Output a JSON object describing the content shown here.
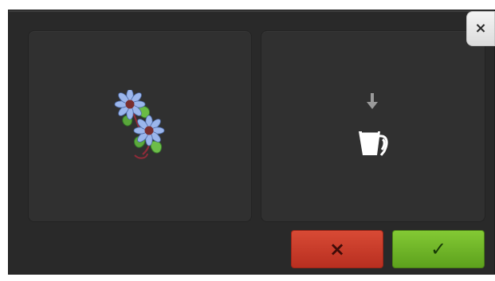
{
  "dialog": {
    "close_icon": "close-icon",
    "close_symbol": "×",
    "design_preview_icon": "flower-embroidery-icon",
    "action_arrow_icon": "arrow-down-icon",
    "action_container_icon": "jug-icon",
    "cancel_icon": "cancel-icon",
    "cancel_symbol": "×",
    "confirm_icon": "checkmark-icon",
    "confirm_symbol": "✓"
  },
  "colors": {
    "window_background": "#292929",
    "panel_background": "#303030",
    "cancel_button": "#c93b2a",
    "confirm_button": "#73b927",
    "flower_petal": "#9bb6ec",
    "flower_center": "#7a2e2e",
    "leaf": "#4f8f33"
  }
}
